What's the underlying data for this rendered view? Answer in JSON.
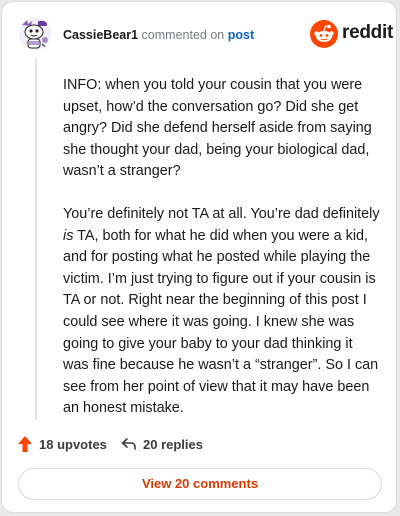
{
  "header": {
    "username": "CassieBear1",
    "action_text": "commented on",
    "post_link": "post",
    "brand": "reddit"
  },
  "comment": {
    "paragraphs": [
      "INFO: when you told your cousin that you were upset, how’d the conversation go? Did she get angry? Did she defend herself aside from saying she thought your dad, being your biological dad, wasn’t a stranger?",
      {
        "before": "You’re definitely not TA at all. You’re dad definitely ",
        "emphasis": "is",
        "after": " TA, both for what he did when you were a kid, and for posting what he posted while playing the victim. I’m just trying to figure out if your cousin is TA or not. Right near the beginning of this post I could see where it was going. I knew she was going to give your baby to your dad thinking it was fine because he wasn’t a “stranger”. So I can see from her point of view that it may have been an honest mistake."
      }
    ]
  },
  "actions": {
    "upvotes": "18 upvotes",
    "replies": "20 replies"
  },
  "view_button": "View 20 comments",
  "icons": {
    "upvote": "arrow-up-icon",
    "reply": "reply-arrow-icon",
    "brand": "reddit-snoo-icon",
    "avatar": "snoo-avatar"
  },
  "colors": {
    "accent": "#ff4500",
    "link": "#0a66c2",
    "view_button_text": "#d93a00"
  }
}
